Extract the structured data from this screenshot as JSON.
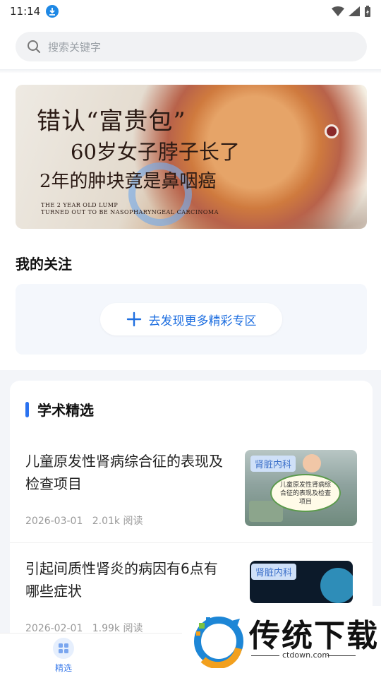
{
  "status_bar": {
    "time": "11:14"
  },
  "search": {
    "placeholder": "搜索关键字"
  },
  "banner": {
    "headline_1": "错认“富贵包”",
    "headline_2": "60岁女子脖子长了",
    "headline_3": "2年的肿块竟是鼻咽癌",
    "english_1": "THE 2 YEAR OLD LUMP",
    "english_2": "TURNED OUT TO BE NASOPHARYNGEAL CARCINOMA"
  },
  "follow": {
    "title": "我的关注",
    "discover_label": "去发现更多精彩专区"
  },
  "academic": {
    "title": "学术精选",
    "articles": [
      {
        "title": "儿童原发性肾病综合征的表现及检查项目",
        "date": "2026-03-01",
        "reads": "2.01k 阅读",
        "tag": "肾脏内科",
        "thumb_caption": "儿童原发性肾病综合征的表现及检查项目"
      },
      {
        "title": "引起间质性肾炎的病因有6点有哪些症状",
        "date": "2026-02-01",
        "reads": "1.99k 阅读",
        "tag": "肾脏内科"
      }
    ]
  },
  "tabbar": {
    "tabs": [
      {
        "label": "精选",
        "active": true
      }
    ]
  },
  "watermark": {
    "brand": "传统下载",
    "url": "ctdown.com"
  },
  "colors": {
    "accent": "#2a72f0",
    "tab_active": "#3b7bea"
  }
}
